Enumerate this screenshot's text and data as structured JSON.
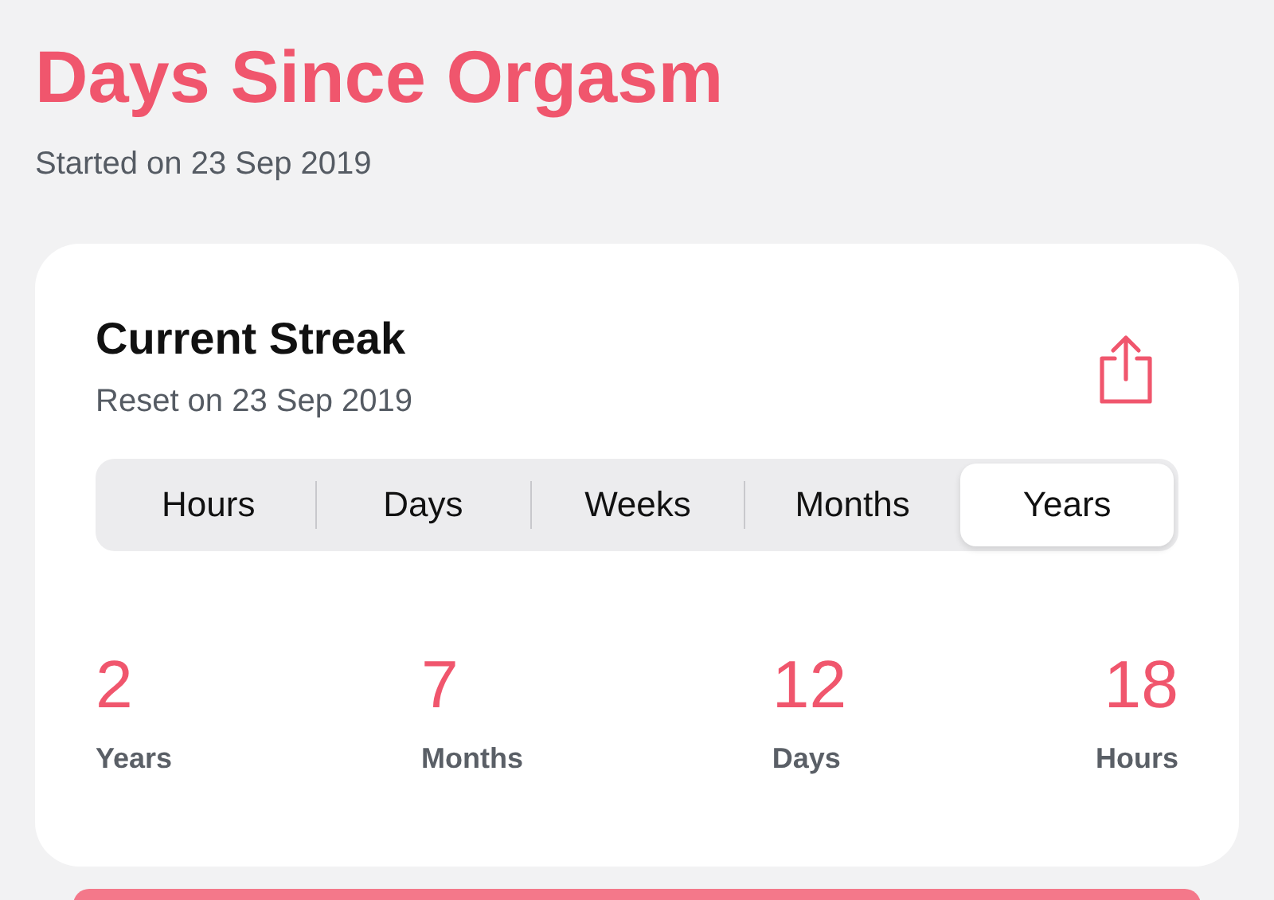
{
  "title": "Days Since Orgasm",
  "subtitle": "Started on 23 Sep 2019",
  "card": {
    "title": "Current Streak",
    "subtitle": "Reset on 23 Sep 2019",
    "segments": [
      {
        "label": "Hours",
        "selected": false
      },
      {
        "label": "Days",
        "selected": false
      },
      {
        "label": "Weeks",
        "selected": false
      },
      {
        "label": "Months",
        "selected": false
      },
      {
        "label": "Years",
        "selected": true
      }
    ],
    "stats": [
      {
        "value": "2",
        "unit": "Years"
      },
      {
        "value": "7",
        "unit": "Months"
      },
      {
        "value": "12",
        "unit": "Days"
      },
      {
        "value": "18",
        "unit": "Hours"
      }
    ]
  }
}
